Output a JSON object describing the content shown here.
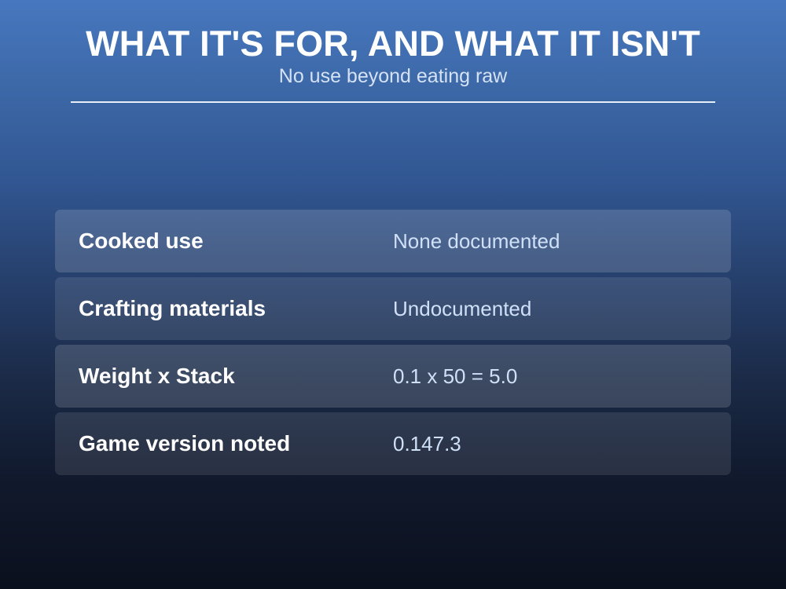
{
  "header": {
    "title": "WHAT IT'S FOR, AND WHAT IT ISN'T",
    "subtitle": "No use beyond eating raw"
  },
  "rows": [
    {
      "label": "Cooked use",
      "value": "None documented"
    },
    {
      "label": "Crafting materials",
      "value": "Undocumented"
    },
    {
      "label": "Weight x Stack",
      "value": "0.1 x 50 = 5.0"
    },
    {
      "label": "Game version noted",
      "value": "0.147.3"
    }
  ],
  "colors": {
    "background_top": "#4777bf",
    "background_bottom": "#0b101d",
    "value_text": "#cfe0f7"
  }
}
